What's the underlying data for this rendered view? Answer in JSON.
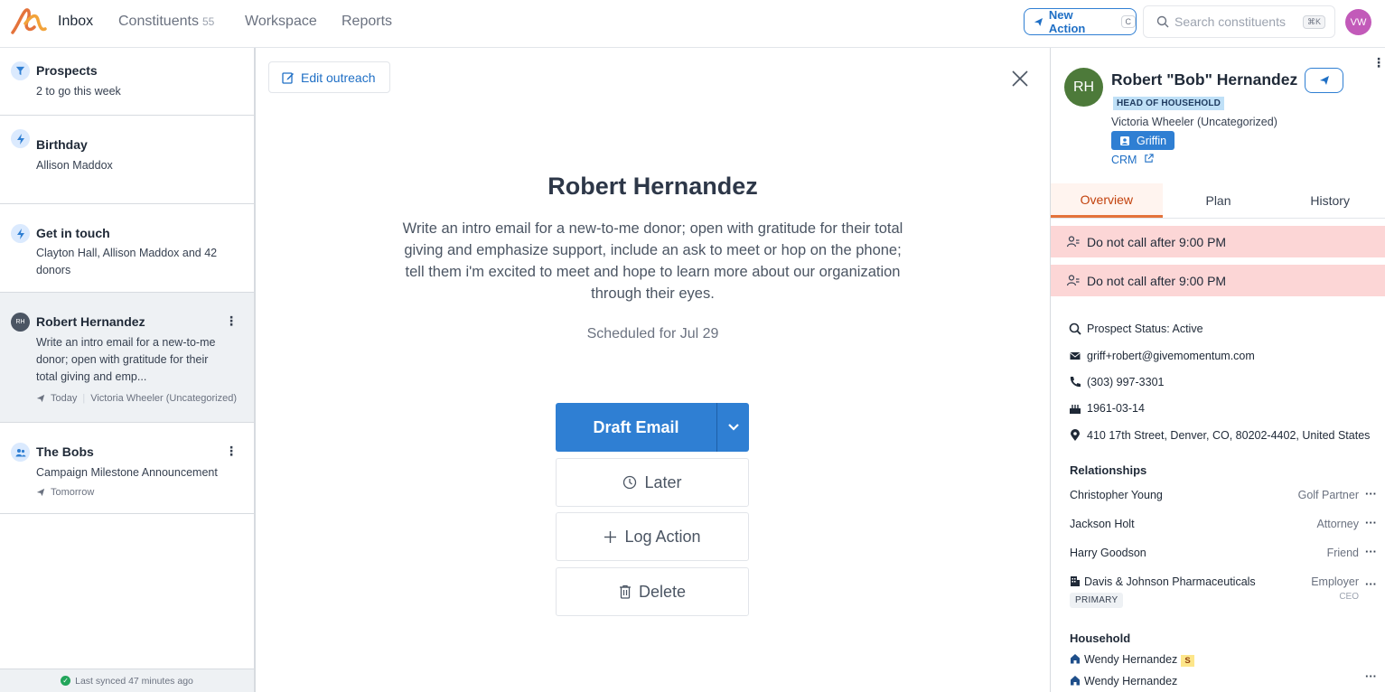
{
  "nav": {
    "items": [
      "Inbox",
      "Constituents",
      "Workspace",
      "Reports"
    ],
    "constituents_count": "55",
    "new_action_label": "New Action",
    "new_action_shortcut": "C",
    "search_placeholder": "Search constituents",
    "search_shortcut": "⌘K",
    "user_initials": "VW"
  },
  "sidebar": {
    "cards": [
      {
        "title": "Prospects",
        "sub": "2 to go this week",
        "icon": "filter-icon"
      },
      {
        "title": "Birthday",
        "sub": "Allison Maddox",
        "icon": "lightning-icon"
      },
      {
        "title": "Get in touch",
        "sub": "Clayton Hall, Allison Maddox and 42 donors",
        "icon": "lightning-icon"
      },
      {
        "title": "Robert Hernandez",
        "sub": "Write an intro email for a new-to-me donor; open with gratitude for their total giving and emp...",
        "initials": "RH",
        "when": "Today",
        "owner": "Victoria Wheeler (Uncategorized)"
      },
      {
        "title": "The Bobs",
        "sub": "Campaign Milestone Announcement",
        "when": "Tomorrow",
        "icon": "group-icon"
      }
    ],
    "sync_text": "Last synced 47 minutes ago"
  },
  "center": {
    "edit_label": "Edit outreach",
    "title": "Robert Hernandez",
    "description": "Write an intro email for a new-to-me donor; open with gratitude for their total giving and emphasize support, include an ask to meet or hop on the phone; tell them i'm excited to meet and hope to learn more about our organization through their eyes.",
    "scheduled": "Scheduled for Jul 29",
    "draft_label": "Draft Email",
    "later_label": "Later",
    "log_label": "Log Action",
    "delete_label": "Delete"
  },
  "profile": {
    "initials": "RH",
    "name": "Robert \"Bob\" Hernandez",
    "badge": "HEAD OF HOUSEHOLD",
    "owner": "Victoria Wheeler (Uncategorized)",
    "assignee": "Griffin",
    "crm_label": "CRM",
    "tabs": [
      "Overview",
      "Plan",
      "History"
    ],
    "alerts": [
      "Do not call after 9:00 PM",
      "Do not call after 9:00 PM"
    ],
    "prospect_status": "Prospect Status: Active",
    "email": "griff+robert@givemomentum.com",
    "phone": "(303) 997-3301",
    "birthday": "1961-03-14",
    "address": "410 17th Street, Denver, CO, 80202-4402, United States",
    "relationships_title": "Relationships",
    "relationships": [
      {
        "name": "Christopher Young",
        "role": "Golf Partner"
      },
      {
        "name": "Jackson Holt",
        "role": "Attorney"
      },
      {
        "name": "Harry Goodson",
        "role": "Friend"
      },
      {
        "name": "Davis & Johnson Pharmaceuticals",
        "role": "Employer",
        "sub_role": "CEO",
        "tag": "PRIMARY"
      }
    ],
    "household_title": "Household",
    "household": [
      {
        "name": "Wendy Hernandez",
        "badge": "S"
      },
      {
        "name": "Wendy Hernandez"
      }
    ]
  },
  "colors": {
    "accent": "#2f7fd3",
    "alert_bg": "#fcd6d6",
    "tab_active": "#e4733b"
  }
}
